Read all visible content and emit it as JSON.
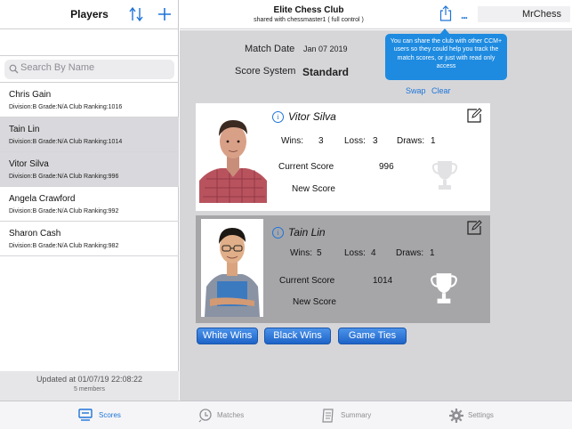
{
  "left": {
    "title": "Players",
    "search_placeholder": "Search By Name",
    "players": [
      {
        "name": "Chris Gain",
        "info": "Division:B   Grade:N/A  Club Ranking:1016",
        "selected": false
      },
      {
        "name": "Tain Lin",
        "info": "Division:B   Grade:N/A  Club Ranking:1014",
        "selected": true
      },
      {
        "name": "Vitor Silva",
        "info": "Division:B   Grade:N/A  Club Ranking:996",
        "selected": true
      },
      {
        "name": "Angela Crawford",
        "info": "Division:B   Grade:N/A  Club Ranking:992",
        "selected": false
      },
      {
        "name": "Sharon Cash",
        "info": "Division:B   Grade:N/A  Club Ranking:982",
        "selected": false
      }
    ],
    "updated": "Updated at 01/07/19 22:08:22",
    "members": "5 members",
    "icons": {
      "sort": "sort-icon",
      "add": "plus-icon",
      "search": "magnifier-icon"
    }
  },
  "header": {
    "club_name": "Elite Chess Club",
    "shared": "shared with chessmaster1  ( full control )",
    "more": "...",
    "user": "MrChess",
    "icons": {
      "share": "share-icon"
    }
  },
  "match": {
    "date_label": "Match Date",
    "date_value": "Jan 07 2019",
    "score_system_label": "Score System",
    "score_system_value": "Standard",
    "swap": "Swap",
    "clear": "Clear"
  },
  "tooltip": "You can share the club with other CCM+ users so they could help you track the match scores, or just with read only access",
  "white": {
    "name": "Vitor Silva",
    "wins_label": "Wins:",
    "wins": "3",
    "loss_label": "Loss:",
    "loss": "3",
    "draws_label": "Draws:",
    "draws": "1",
    "current_label": "Current Score",
    "current": "996",
    "new_label": "New Score"
  },
  "black": {
    "name": "Tain Lin",
    "wins_label": "Wins:",
    "wins": "5",
    "loss_label": "Loss:",
    "loss": "4",
    "draws_label": "Draws:",
    "draws": "1",
    "current_label": "Current Score",
    "current": "1014",
    "new_label": "New Score"
  },
  "buttons": {
    "white_wins": "White Wins",
    "black_wins": "Black Wins",
    "game_ties": "Game Ties"
  },
  "tabs": [
    {
      "label": "Scores",
      "icon": "scores-icon",
      "active": true
    },
    {
      "label": "Matches",
      "icon": "matches-icon",
      "active": false
    },
    {
      "label": "Summary",
      "icon": "summary-icon",
      "active": false
    },
    {
      "label": "Settings",
      "icon": "gear-icon",
      "active": false
    }
  ],
  "colors": {
    "accent": "#1e74d8",
    "tooltip": "#1e8be0",
    "white_card": "#ffffff",
    "black_card": "#a6a6a9",
    "panel": "#d6d6d9"
  }
}
